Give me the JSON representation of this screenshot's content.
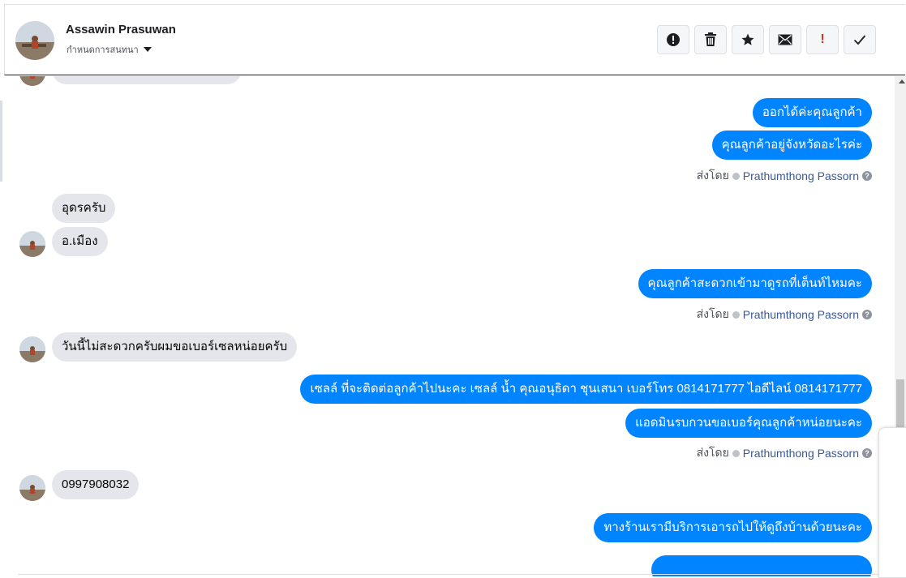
{
  "header": {
    "contact_name": "Assawin Prasuwan",
    "conversation_label": "กำหนดการสนทนา"
  },
  "toolbar": {
    "buttons": [
      {
        "name": "report-spam",
        "icon": "exclamation-circle-icon"
      },
      {
        "name": "delete",
        "icon": "trash-icon"
      },
      {
        "name": "star",
        "icon": "star-icon"
      },
      {
        "name": "mark-unread",
        "icon": "envelope-icon"
      },
      {
        "name": "follow-up",
        "icon": "exclamation-mark-icon",
        "label": "!"
      },
      {
        "name": "mark-done",
        "icon": "checkmark-icon"
      }
    ]
  },
  "messages": [
    {
      "direction": "out",
      "text": "ออกได้ค่ะคุณลูกค้า"
    },
    {
      "direction": "out",
      "text": "คุณลูกค้าอยู่จังหวัดอะไรค่ะ"
    },
    {
      "direction": "in",
      "text": "อุดรครับ"
    },
    {
      "direction": "in",
      "text": "อ.เมือง"
    },
    {
      "direction": "out",
      "text": "คุณลูกค้าสะดวกเข้ามาดูรถที่เต็นท์ไหมคะ"
    },
    {
      "direction": "in",
      "text": "วันนี้ไม่สะดวกครับผมขอเบอร์เซลหน่อยครับ"
    },
    {
      "direction": "out",
      "text": "เซลล์ ที่จะติดต่อลูกค้าไปนะคะ เซลล์ น้ำ คุณอนุธิดา ชุนเสนา เบอร์โทร 0814171777 ไอดีไลน์ 0814171777"
    },
    {
      "direction": "out",
      "text": "แอดมินรบกวนขอเบอร์คุณลูกค้าหน่อยนะคะ"
    },
    {
      "direction": "in",
      "text": "0997908032"
    },
    {
      "direction": "out",
      "text": "ทางร้านเรามีบริการเอารถไปให้ดูถึงบ้านด้วยนะคะ"
    }
  ],
  "sent_by": {
    "prefix": "ส่งโดย",
    "agent": "Prathumthong Passorn"
  },
  "colors": {
    "outgoing_bubble": "#0084ff",
    "incoming_bubble": "#e4e6eb",
    "agent_link": "#385898",
    "follow_up_red": "#d93025"
  }
}
